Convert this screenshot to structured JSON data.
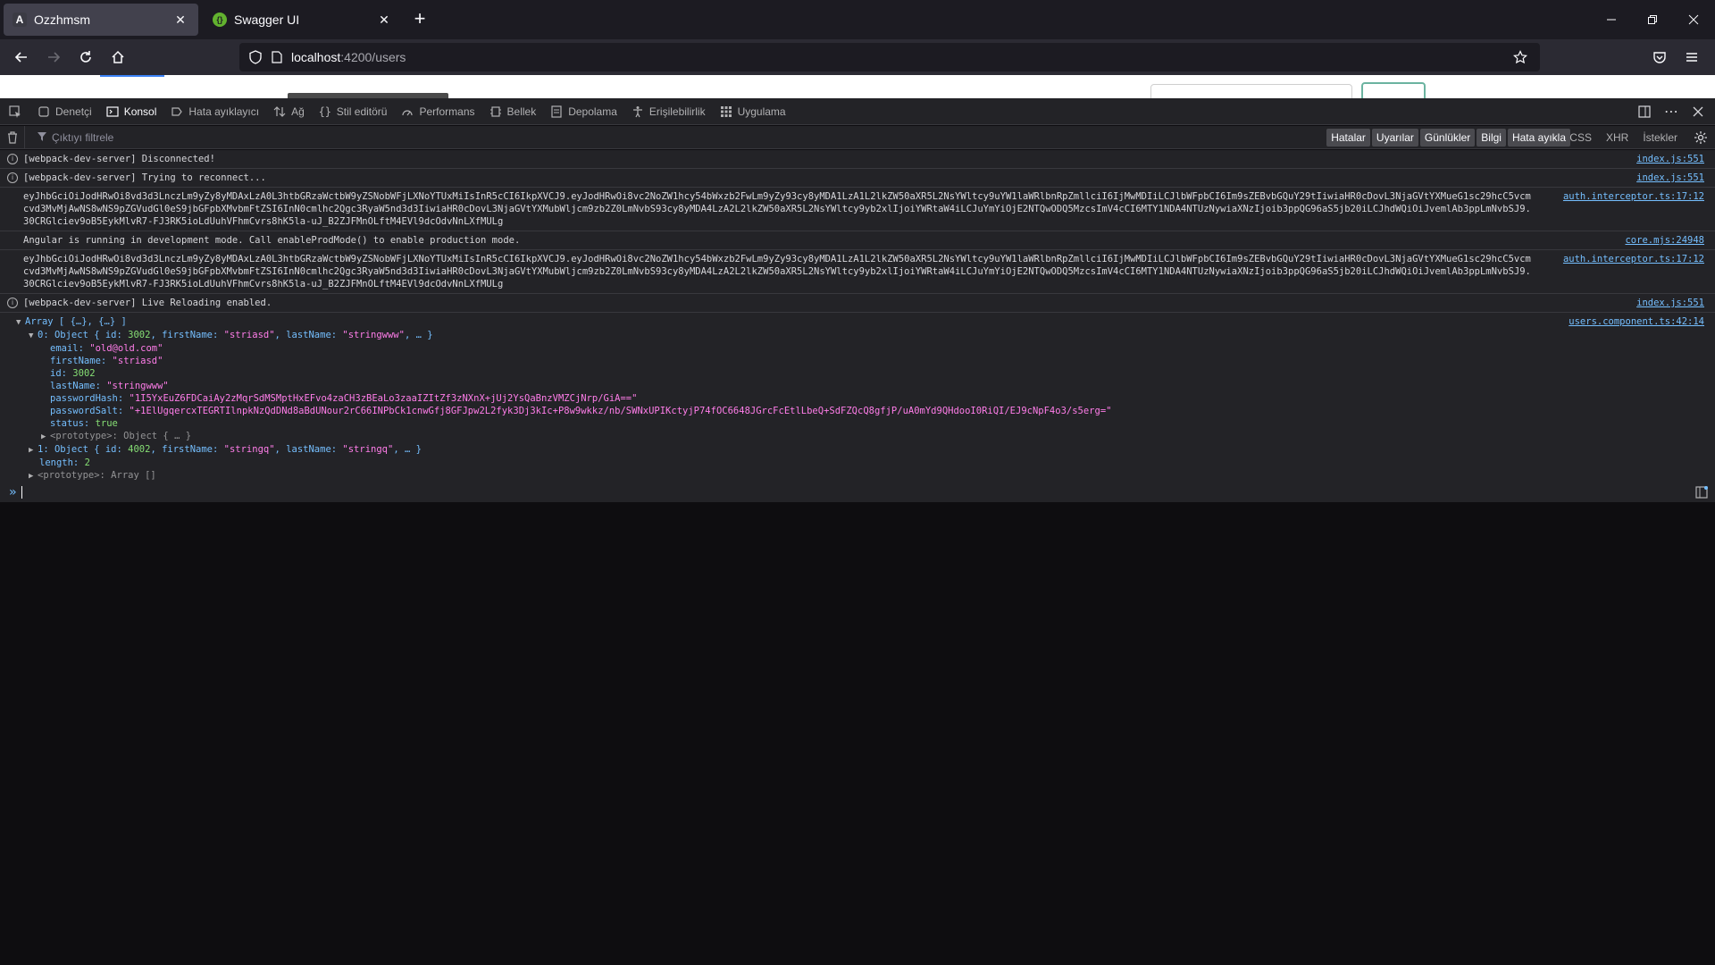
{
  "browser": {
    "tabs": [
      {
        "title": "Ozzhmsm",
        "favicon": "A",
        "active": true
      },
      {
        "title": "Swagger UI",
        "favicon": "{}",
        "active": false
      }
    ],
    "url": {
      "host": "localhost",
      "path": ":4200/users"
    }
  },
  "devtools": {
    "tabs": [
      {
        "label": "Denetçi",
        "icon": "inspector-icon"
      },
      {
        "label": "Konsol",
        "icon": "console-icon",
        "selected": true
      },
      {
        "label": "Hata ayıklayıcı",
        "icon": "debugger-icon"
      },
      {
        "label": "Ağ",
        "icon": "network-icon"
      },
      {
        "label": "Stil editörü",
        "icon": "style-editor-icon"
      },
      {
        "label": "Performans",
        "icon": "performance-icon"
      },
      {
        "label": "Bellek",
        "icon": "memory-icon"
      },
      {
        "label": "Depolama",
        "icon": "storage-icon"
      },
      {
        "label": "Erişilebilirlik",
        "icon": "accessibility-icon"
      },
      {
        "label": "Uygulama",
        "icon": "application-icon"
      }
    ],
    "filter_placeholder": "Çıktıyı filtrele",
    "levels": [
      "Hatalar",
      "Uyarılar",
      "Günlükler",
      "Bilgi",
      "Hata ayıkla"
    ],
    "net_filters": [
      "CSS",
      "XHR",
      "İstekler"
    ]
  },
  "console": {
    "messages": [
      {
        "type": "info",
        "text": "[webpack-dev-server] Disconnected!",
        "source": "index.js:551"
      },
      {
        "type": "info",
        "text": "[webpack-dev-server] Trying to reconnect...",
        "source": "index.js:551"
      },
      {
        "type": "log",
        "text": "eyJhbGciOiJodHRwOi8vd3d3LnczLm9yZy8yMDAxLzA0L3htbGRzaWctbW9yZSNobWFjLXNoYTUxMiIsInR5cCI6IkpXVCJ9.eyJodHRwOi8vc2NoZW1hcy54bWxzb2FwLm9yZy93cy8yMDA1LzA1L2lkZW50aXR5L2NsYWltcy9uYW1laWRlbnRpZmllciI6IjMwMDIiLCJlbWFpbCI6Im9sZEBvbGQuY29tIiwiaHR0cDovL3NjaGVtYXMueG1sc29hcC5vcmcvd3MvMjAwNS8wNS9pZGVudGl0eS9jbGFpbXMvbmFtZSI6InN0cmlhc2Qgc3RyaW5nd3d3IiwiaHR0cDovL3NjaGVtYXMubWljcm9zb2Z0LmNvbS93cy8yMDA4LzA2L2lkZW50aXR5L2NsYWltcy9yb2xlIjoiYWRtaW4iLCJuYmYiOjE2NTQwODQ5MzcsImV4cCI6MTY1NDA4NTUzNywiaXNzIjoib3ppQG96aS5jb20iLCJhdWQiOiJvemlAb3ppLmNvbSJ9.30CRGlciev9oB5EykMlvR7-FJ3RK5ioLdUuhVFhmCvrs8hK5la-uJ_B2ZJFMnOLftM4EVl9dcOdvNnLXfMULg",
        "source": "auth.interceptor.ts:17:12"
      },
      {
        "type": "log",
        "text": "Angular is running in development mode. Call enableProdMode() to enable production mode.",
        "source": "core.mjs:24948"
      },
      {
        "type": "log",
        "text": "eyJhbGciOiJodHRwOi8vd3d3LnczLm9yZy8yMDAxLzA0L3htbGRzaWctbW9yZSNobWFjLXNoYTUxMiIsInR5cCI6IkpXVCJ9.eyJodHRwOi8vc2NoZW1hcy54bWxzb2FwLm9yZy93cy8yMDA1LzA1L2lkZW50aXR5L2NsYWltcy9uYW1laWRlbnRpZmllciI6IjMwMDIiLCJlbWFpbCI6Im9sZEBvbGQuY29tIiwiaHR0cDovL3NjaGVtYXMueG1sc29hcC5vcmcvd3MvMjAwNS8wNS9pZGVudGl0eS9jbGFpbXMvbmFtZSI6InN0cmlhc2Qgc3RyaW5nd3d3IiwiaHR0cDovL3NjaGVtYXMubWljcm9zb2Z0LmNvbS93cy8yMDA4LzA2L2lkZW50aXR5L2NsYWltcy9yb2xlIjoiYWRtaW4iLCJuYmYiOjE2NTQwODQ5MzcsImV4cCI6MTY1NDA4NTUzNywiaXNzIjoib3ppQG96aS5jb20iLCJhdWQiOiJvemlAb3ppLmNvbSJ9.30CRGlciev9oB5EykMlvR7-FJ3RK5ioLdUuhVFhmCvrs8hK5la-uJ_B2ZJFMnOLftM4EVl9dcOdvNnLXfMULg",
        "source": "auth.interceptor.ts:17:12"
      },
      {
        "type": "info",
        "text": "[webpack-dev-server] Live Reloading enabled.",
        "source": "index.js:551"
      }
    ],
    "array_log": {
      "source": "users.component.ts:42:14",
      "header": "Array [ {…}, {…} ]",
      "item0_header": {
        "prefix": "0: Object { id: ",
        "id": "3002",
        "mid1": ", firstName: ",
        "firstName": "\"striasd\"",
        "mid2": ", lastName: ",
        "lastName": "\"stringwww\"",
        "suffix": ", … }"
      },
      "item0": {
        "email": "\"old@old.com\"",
        "firstName": "\"striasd\"",
        "id": "3002",
        "lastName": "\"stringwww\"",
        "passwordHash": "\"1I5YxEuZ6FDCaiAy2zMqrSdMSMptHxEFvo4zaCH3zBEaLo3zaaIZItZf3zNXnX+jUj2YsQaBnzVMZCjNrp/GiA==\"",
        "passwordSalt": "\"+1ElUgqercxTEGRTIlnpkNzQdDNd8aBdUNour2rC66INPbCk1cnwGfj8GFJpw2L2fyk3Dj3kIc+P8w9wkkz/nb/SWNxUPIKctyjP74fOC6648JGrcFcEtlLbeQ+SdFZQcQ8gfjP/uA0mYd9QHdooI0RiQI/EJ9cNpF4o3/s5erg=\"",
        "status": "true",
        "proto": "<prototype>: Object { … }"
      },
      "item1_header": {
        "prefix": "1: Object { id: ",
        "id": "4002",
        "mid1": ", firstName: ",
        "firstName": "\"stringq\"",
        "mid2": ", lastName: ",
        "lastName": "\"stringq\"",
        "suffix": ", … }"
      },
      "length": "2",
      "proto": "<prototype>: Array []"
    }
  },
  "colors": {
    "link": "#75bfff",
    "string": "#ff7de9",
    "number": "#86de74",
    "accent": "#75bfff"
  }
}
